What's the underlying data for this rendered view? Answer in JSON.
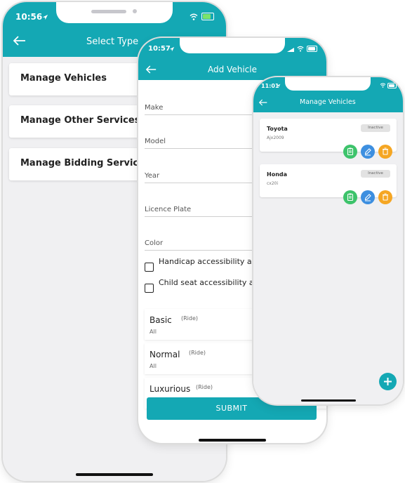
{
  "screen1": {
    "time": "10:56",
    "title": "Select Type",
    "menu": [
      {
        "label": "Manage Vehicles"
      },
      {
        "label": "Manage Other Services"
      },
      {
        "label": "Manage Bidding Services"
      }
    ]
  },
  "screen2": {
    "time": "10:57",
    "title": "Add Vehicle",
    "fields": [
      {
        "label": "Make"
      },
      {
        "label": "Model"
      },
      {
        "label": "Year"
      },
      {
        "label": "Licence Plate"
      },
      {
        "label": "Color"
      }
    ],
    "checkboxes": [
      {
        "label": "Handicap accessibility a Ride service?"
      },
      {
        "label": "Child seat accessibility a Ride service?"
      }
    ],
    "categories": [
      {
        "name": "Basic",
        "tag": "(Ride)",
        "sub": "All"
      },
      {
        "name": "Normal",
        "tag": "(Ride)",
        "sub": "All"
      },
      {
        "name": "Luxurious",
        "tag": "(Ride)",
        "sub": ""
      }
    ],
    "submit_label": "SUBMIT"
  },
  "screen3": {
    "time": "11:01",
    "title": "Manage Vehicles",
    "vehicles": [
      {
        "name": "Toyota",
        "sub": "Ajx2009",
        "status": "Inactive"
      },
      {
        "name": "Honda",
        "sub": "cx20i",
        "status": "Inactive"
      }
    ],
    "action_icons": [
      "clipboard-icon",
      "edit-icon",
      "trash-icon"
    ],
    "colors": {
      "accent": "#14a8b4",
      "green": "#3dc36b",
      "blue": "#3d8fe0",
      "orange": "#f5a623"
    }
  }
}
